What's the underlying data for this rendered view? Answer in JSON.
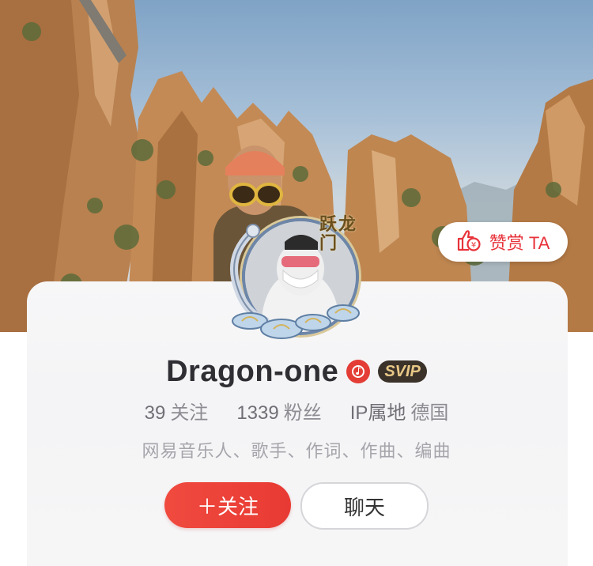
{
  "profile": {
    "frame_text": "跃龙门",
    "tip_label": "赞赏 TA",
    "name": "Dragon-one",
    "svip_label": "SVIP",
    "stats": [
      {
        "value": "39",
        "label": "关注"
      },
      {
        "value": "1339",
        "label": "粉丝"
      }
    ],
    "ip": {
      "label": "IP属地",
      "value": "德国"
    },
    "bio": "网易音乐人、歌手、作词、作曲、编曲",
    "follow_label": "＋关注",
    "chat_label": "聊天"
  },
  "colors": {
    "accent_red": "#e8323a",
    "svip_bg": "#3b332a",
    "svip_text": "#e8c887"
  },
  "icons": [
    "thumb-coin-icon",
    "music-note-badge-icon",
    "svip-badge-icon",
    "dragon-frame-icon"
  ]
}
